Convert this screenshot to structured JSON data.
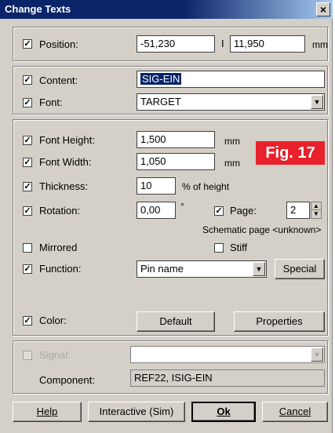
{
  "window": {
    "title": "Change Texts",
    "close_glyph": "×"
  },
  "position": {
    "label": "Position:",
    "x": "-51,230",
    "separator": "I",
    "y": "11,950",
    "unit": "mm"
  },
  "content": {
    "label": "Content:",
    "value": "SIG-EIN"
  },
  "font": {
    "label": "Font:",
    "value": "TARGET"
  },
  "font_height": {
    "label": "Font Height:",
    "value": "1,500",
    "unit": "mm"
  },
  "font_width": {
    "label": "Font Width:",
    "value": "1,050",
    "unit": "mm"
  },
  "figure_badge": "Fig. 17",
  "thickness": {
    "label": "Thickness:",
    "value": "10",
    "unit": "% of height"
  },
  "rotation": {
    "label": "Rotation:",
    "value": "0,00",
    "unit": "°"
  },
  "page": {
    "label": "Page:",
    "value": "2"
  },
  "schematic_page": "Schematic page <unknown>",
  "mirrored": {
    "label": "Mirrored"
  },
  "stiff": {
    "label": "Stiff"
  },
  "function": {
    "label": "Function:",
    "value": "Pin name",
    "special_button": "Special"
  },
  "color": {
    "label": "Color:",
    "default_button": "Default",
    "properties_button": "Properties"
  },
  "signal": {
    "label": "Signal:",
    "value": ""
  },
  "component": {
    "label": "Component:",
    "value": "REF22, ISIG-EIN"
  },
  "buttons": {
    "help": "Help",
    "interactive": "Interactive (Sim)",
    "ok": "Ok",
    "cancel": "Cancel"
  },
  "check_mark": "✓",
  "icons": {
    "dropdown": "chevron-down-icon",
    "spin": "spin-arrows-icon"
  },
  "colors": {
    "titlebar": "#0a246a",
    "badge": "#e8212c",
    "dialog_bg": "#d4d0c8"
  }
}
